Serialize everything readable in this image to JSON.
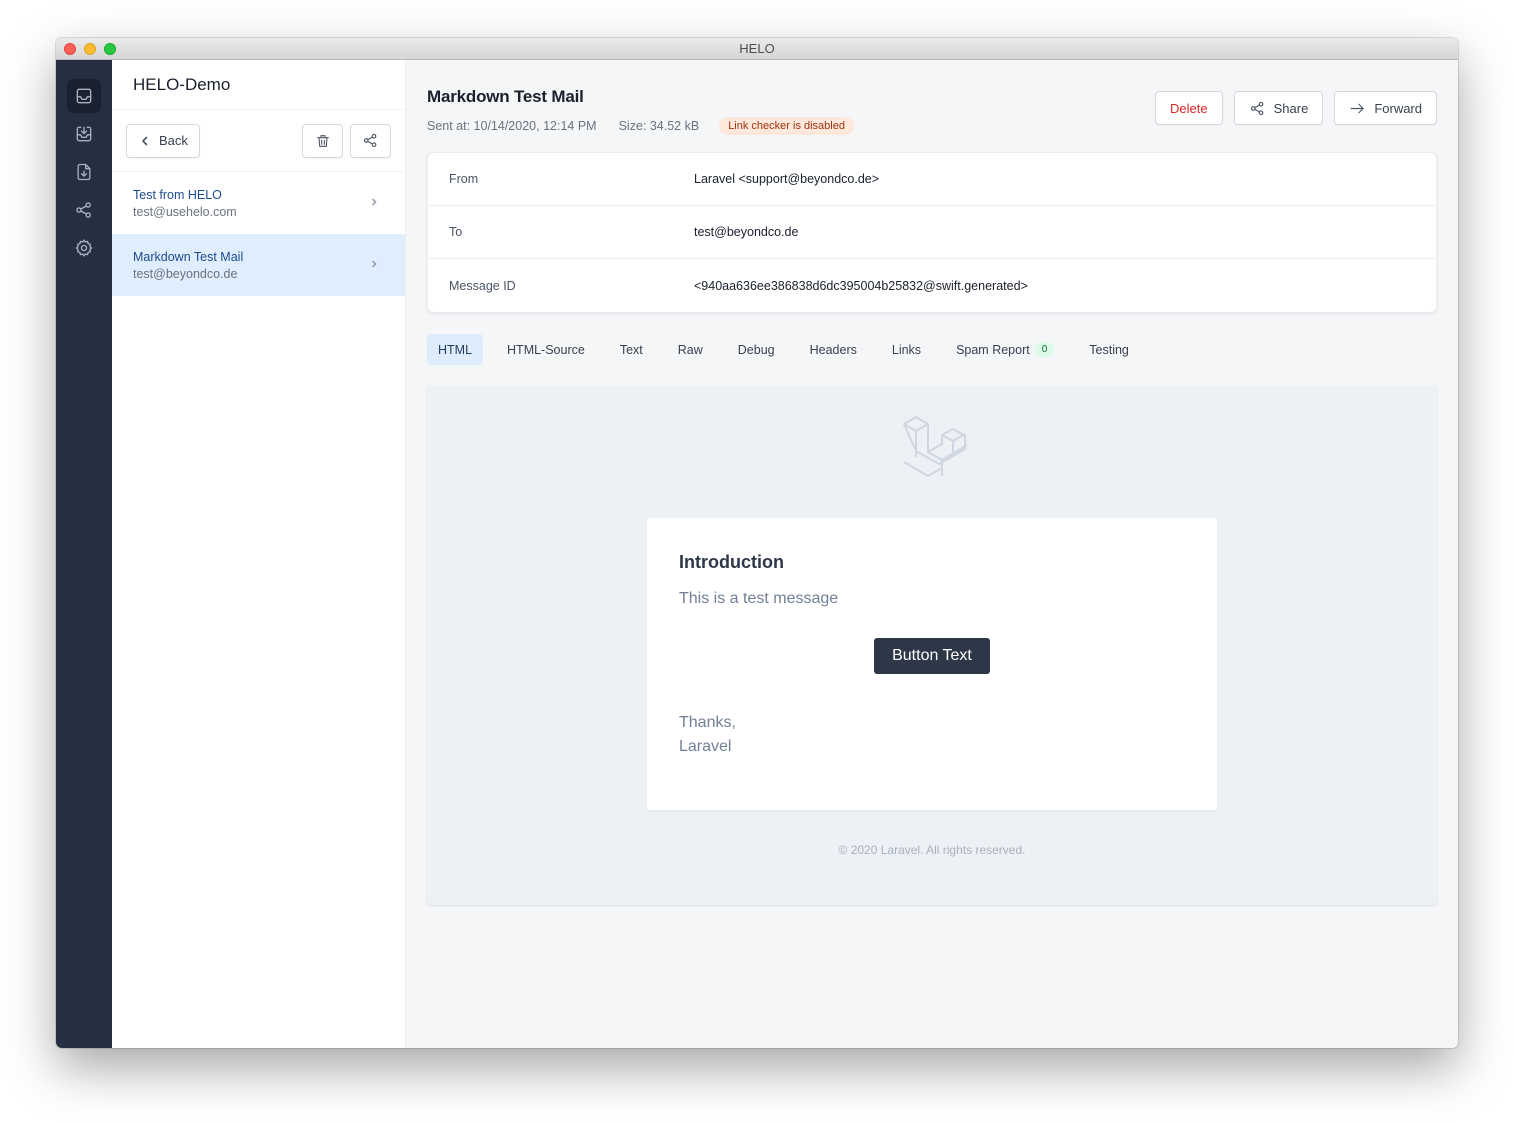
{
  "window": {
    "title": "HELO"
  },
  "rail": {
    "items": [
      {
        "icon": "inbox-icon",
        "active": true
      },
      {
        "icon": "inbox-download-icon",
        "active": false
      },
      {
        "icon": "document-download-icon",
        "active": false
      },
      {
        "icon": "share-icon",
        "active": false
      },
      {
        "icon": "gear-icon",
        "active": false
      }
    ]
  },
  "list": {
    "title": "HELO-Demo",
    "back_label": "Back",
    "items": [
      {
        "subject": "Test from HELO",
        "from": "test@usehelo.com",
        "selected": false
      },
      {
        "subject": "Markdown Test Mail",
        "from": "test@beyondco.de",
        "selected": true
      }
    ]
  },
  "message": {
    "subject": "Markdown Test Mail",
    "sent_at": "Sent at: 10/14/2020, 12:14 PM",
    "size": "Size: 34.52 kB",
    "link_badge": "Link checker is disabled",
    "actions": {
      "delete": "Delete",
      "share": "Share",
      "forward": "Forward"
    },
    "headers": [
      {
        "label": "From",
        "value": "Laravel <support@beyondco.de>"
      },
      {
        "label": "To",
        "value": "test@beyondco.de"
      },
      {
        "label": "Message ID",
        "value": "<940aa636ee386838d6dc395004b25832@swift.generated>"
      }
    ]
  },
  "tabs": [
    {
      "label": "HTML",
      "active": true
    },
    {
      "label": "HTML-Source"
    },
    {
      "label": "Text"
    },
    {
      "label": "Raw"
    },
    {
      "label": "Debug"
    },
    {
      "label": "Headers"
    },
    {
      "label": "Links"
    },
    {
      "label": "Spam Report",
      "badge": "0"
    },
    {
      "label": "Testing"
    }
  ],
  "preview": {
    "heading": "Introduction",
    "body": "This is a test message",
    "button": "Button Text",
    "sign_1": "Thanks,",
    "sign_2": "Laravel",
    "footer": "© 2020 Laravel. All rights reserved."
  }
}
